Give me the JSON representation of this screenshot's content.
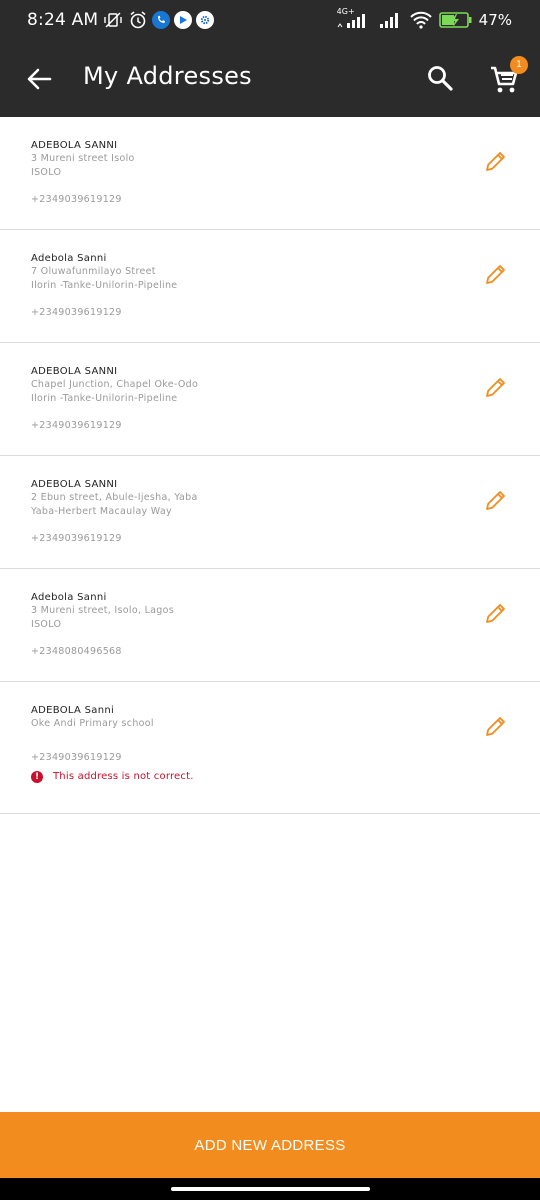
{
  "status_bar": {
    "time": "8:24 AM",
    "network": "4G+",
    "battery": "47%"
  },
  "app_bar": {
    "title": "My Addresses",
    "cart_count": "1"
  },
  "colors": {
    "accent": "#f28c1e",
    "bar_bg": "#2b2b2b",
    "error": "#c8102e"
  },
  "addresses": [
    {
      "name": "ADEBOLA SANNI",
      "line1": "3 Mureni street Isolo",
      "line2": "ISOLO",
      "phone": "+2349039619129"
    },
    {
      "name": "Adebola Sanni",
      "line1": "7 Oluwafunmilayo Street",
      "line2": "Ilorin -Tanke-Unilorin-Pipeline",
      "phone": "+2349039619129"
    },
    {
      "name": "ADEBOLA SANNI",
      "line1": "Chapel Junction, Chapel Oke-Odo",
      "line2": "Ilorin -Tanke-Unilorin-Pipeline",
      "phone": "+2349039619129"
    },
    {
      "name": "ADEBOLA SANNI",
      "line1": "2 Ebun street, Abule-Ijesha, Yaba",
      "line2": "Yaba-Herbert Macaulay Way",
      "phone": "+2349039619129"
    },
    {
      "name": "Adebola Sanni",
      "line1": "3 Mureni street, Isolo, Lagos",
      "line2": "ISOLO",
      "phone": "+2348080496568"
    },
    {
      "name": "ADEBOLA Sanni",
      "line1": "Oke Andi Primary school",
      "phone": "+2349039619129",
      "error": "This address is not correct."
    }
  ],
  "add_button_label": "ADD NEW ADDRESS"
}
